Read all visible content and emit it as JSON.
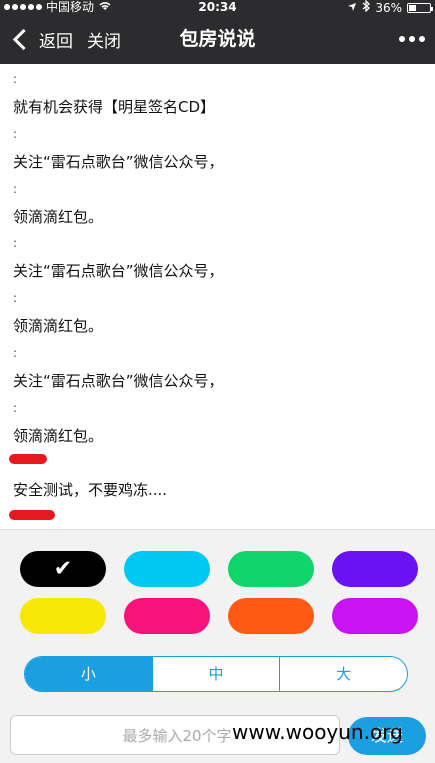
{
  "status_bar": {
    "carrier": "中国移动",
    "time": "20:34",
    "battery": "36%",
    "battery_level": 0.36
  },
  "nav": {
    "back_label": "返回",
    "close_label": "关闭",
    "title": "包房说说"
  },
  "content": {
    "lines": [
      ":",
      "就有机会获得【明星签名CD】",
      ":",
      "关注“雷石点歌台”微信公众号，",
      ":",
      "领滴滴红包。",
      ":",
      "关注“雷石点歌台”微信公众号，",
      ":",
      "领滴滴红包。",
      ":",
      "关注“雷石点歌台”微信公众号，",
      ":",
      "领滴滴红包。",
      "安全测试，不要鸡冻...."
    ]
  },
  "colors": {
    "swatches": [
      "#000000",
      "#00c8f5",
      "#0fd56b",
      "#6b12f5",
      "#f8e808",
      "#f8137a",
      "#ff5a13",
      "#c913f5"
    ],
    "selected_index": 0,
    "accent": "#1aa0e0"
  },
  "size_options": [
    "小",
    "中",
    "大"
  ],
  "size_selected": "小",
  "input": {
    "placeholder": "最多输入20个字"
  },
  "send_label": "发送",
  "watermark": "www.wooyun.org"
}
